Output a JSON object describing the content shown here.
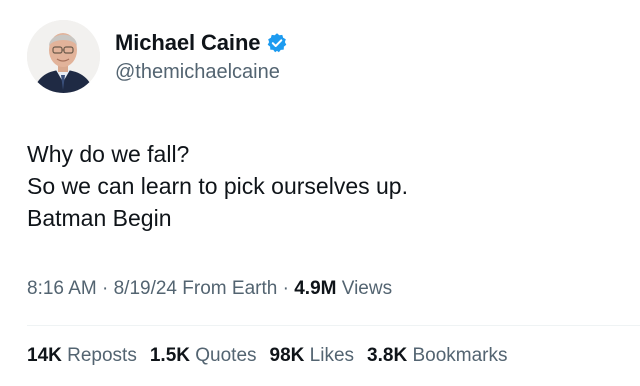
{
  "author": {
    "display_name": "Michael Caine",
    "handle": "@themichaelcaine",
    "verified_badge_icon": "verified-check-icon",
    "badge_color": "#1d9bf0"
  },
  "tweet": {
    "lines": [
      "Why do we fall?",
      "So we can learn to pick ourselves up.",
      "Batman Begin"
    ]
  },
  "meta": {
    "time": "8:16 AM",
    "sep1": " · ",
    "date": "8/19/24",
    "source": " From Earth",
    "sep2": " · ",
    "views_count": "4.9M",
    "views_label": " Views"
  },
  "stats": {
    "reposts_count": "14K",
    "reposts_label": " Reposts",
    "quotes_count": "1.5K",
    "quotes_label": " Quotes",
    "likes_count": "98K",
    "likes_label": " Likes",
    "bookmarks_count": "3.8K",
    "bookmarks_label": " Bookmarks"
  }
}
